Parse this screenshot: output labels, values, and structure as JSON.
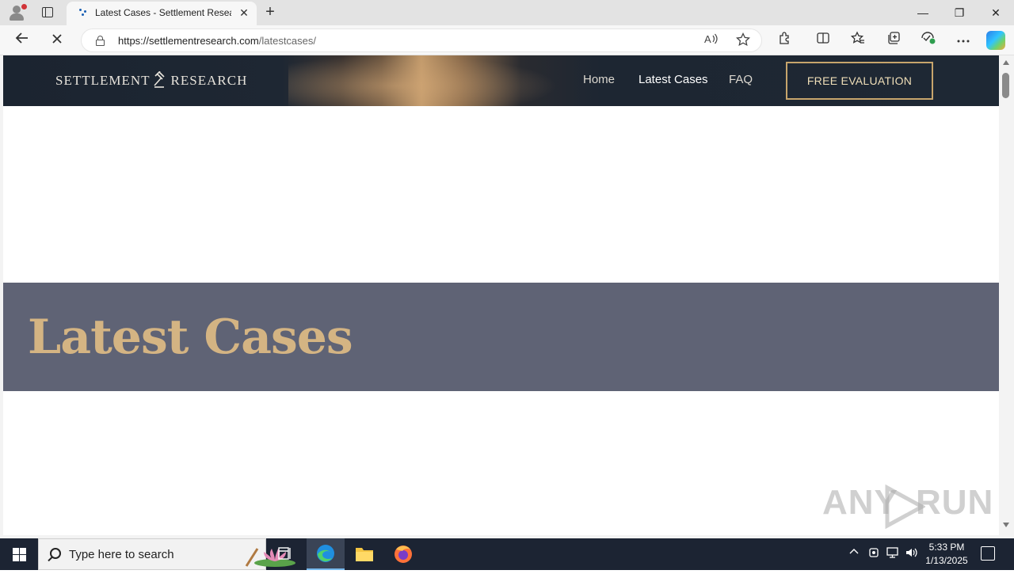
{
  "browser": {
    "tab_title": "Latest Cases - Settlement Research",
    "tab_close": "✕",
    "new_tab": "+",
    "url_host": "https://settlementresearch.com",
    "url_path": "/latestcases/",
    "window": {
      "minimize": "—",
      "restore": "❐",
      "close": "✕"
    }
  },
  "site": {
    "logo_left": "SETTLEMENT",
    "logo_right": "RESEARCH",
    "nav": [
      {
        "label": "Home"
      },
      {
        "label": "Latest Cases"
      },
      {
        "label": "FAQ"
      }
    ],
    "cta_label": "FREE EVALUATION",
    "hero_title": "Latest Cases",
    "accent_color": "#c7a56c",
    "hero_band_color": "#5f6375"
  },
  "watermark": {
    "text_left": "ANY",
    "text_right": "RUN"
  },
  "taskbar": {
    "search_placeholder": "Type here to search",
    "time": "5:33 PM",
    "date": "1/13/2025"
  },
  "icons": {
    "back": "back-arrow-icon",
    "reload": "stop-loading-icon",
    "read_aloud": "read-aloud-icon",
    "favorite": "star-icon"
  }
}
